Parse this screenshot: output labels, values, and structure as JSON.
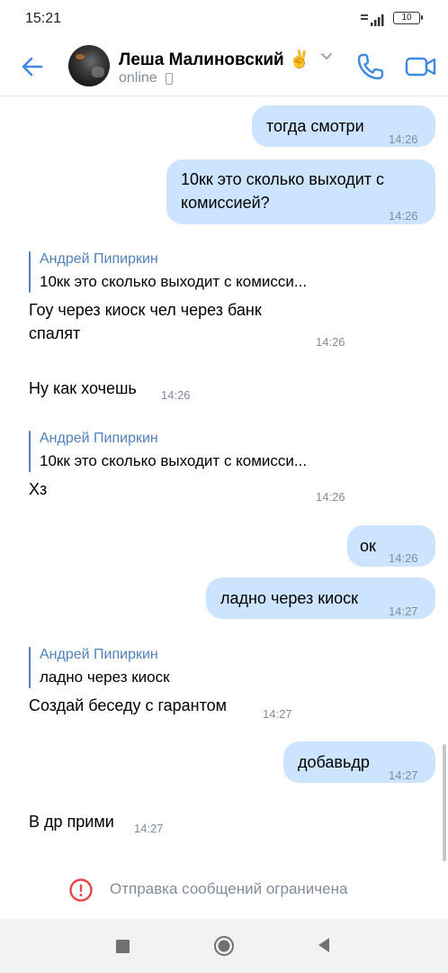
{
  "status_bar": {
    "time": "15:21",
    "battery": "10"
  },
  "header": {
    "contact_name": "Леша Малиновский ✌️",
    "status": "online",
    "back_icon": "arrow-left-icon",
    "call_icon": "phone-icon",
    "video_icon": "video-camera-icon"
  },
  "messages": [
    {
      "direction": "out",
      "text": "тогда смотри",
      "time": "14:26"
    },
    {
      "direction": "out",
      "text_line1": "10кк это сколько выходит с",
      "text_line2": "комиссией?",
      "time": "14:26"
    },
    {
      "direction": "in",
      "reply_author": "Андрей Пипиркин",
      "reply_text": "10кк это сколько выходит с комисси...",
      "text_line1": "Гоу через киоск чел через банк",
      "text_line2": "спалят",
      "time": "14:26"
    },
    {
      "direction": "in",
      "text": "Ну как хочешь",
      "time": "14:26"
    },
    {
      "direction": "in",
      "reply_author": "Андрей Пипиркин",
      "reply_text": "10кк это сколько выходит с комисси...",
      "text": "Хз",
      "time": "14:26"
    },
    {
      "direction": "out",
      "text": "ок",
      "time": "14:26"
    },
    {
      "direction": "out",
      "text": "ладно через киоск",
      "time": "14:27"
    },
    {
      "direction": "in",
      "reply_author": "Андрей Пипиркин",
      "reply_text": "ладно через киоск",
      "text": "Создай беседу с гарантом",
      "time": "14:27"
    },
    {
      "direction": "out",
      "text": "добавьдр",
      "time": "14:27"
    },
    {
      "direction": "in",
      "text": "В др прими",
      "time": "14:27"
    }
  ],
  "footer": {
    "restricted_text": "Отправка сообщений ограничена",
    "icon": "exclamation-circle-icon"
  },
  "colors": {
    "accent": "#5181b8",
    "outgoing_bubble": "#cce4ff",
    "secondary_text": "#818c99",
    "warning": "#e64646"
  }
}
